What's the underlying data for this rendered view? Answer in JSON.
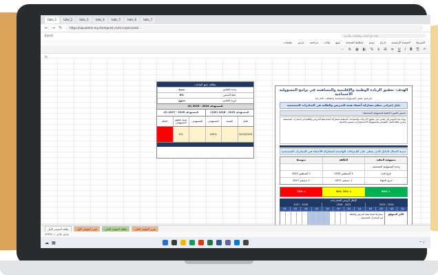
{
  "browser": {
    "tabs": [
      "tabs_1",
      "tabs_2",
      "tabs_3",
      "tabs_4",
      "tabs_5",
      "tabs_6",
      "tabs_7"
    ],
    "url": "https://squadmin-my.sharepoint.com/:x:/personal/...",
    "app_name": "Excel",
    "search_placeholder": "بحث عن أدوات، وتعليمات، والمزيد"
  },
  "menubar": [
    "الشريط",
    "الصفحة الرئيسية",
    "إدراج",
    "رسم",
    "تخطيط الصفحة",
    "صيغ",
    "بيانات",
    "مراجعة",
    "عرض",
    "تعليمات"
  ],
  "left_card": {
    "title": "بطاقة جمع البيانات",
    "rows": [
      {
        "key": "وحدة القياس",
        "value": "نسبة"
      },
      {
        "key": "خط الأساس",
        "value": "0%"
      },
      {
        "key": "دورية القياس",
        "value": "سنوي"
      }
    ],
    "period_main": "المستهدف 2024 - 2025 (0)",
    "periods": [
      "المستهدف 2026 - 2027 (0)",
      "المستهدف 2025 - 2026 (100)"
    ],
    "col_heads": [
      "العام",
      "النتيجة",
      "المستهدف",
      "المستهدف",
      "نسبة تحقيق المستهدف",
      "الحالة"
    ],
    "values": [
      "2023/2024",
      "",
      "100%",
      "",
      "0%",
      ""
    ]
  },
  "right_card": {
    "title": "الهدف: تحقيق الريادة الوطنية والإقليمية والمساهمة في برامج المسؤولية الاجتماعية",
    "subtitle": "البرنامج: تفعيل المسؤولية المجتمعية والعلاقات الخارجية",
    "goal": "دليل إجرائي ينظم مشاركة أعضاء هيئة التدريس والطلبة في المبادرات المجتمعية",
    "indicator": "تحسين الصورة الذهنية للمسؤولية المجتمعية:",
    "description": "يهدف هذا المؤشر إلى قياس مدى تطبيق الإجراءات والسياسات المنظمة لمشاركة أعضاء هيئة التدريس والطلبة في المبادرات المجتمعية وتعزيز ثقافة العمل التطوعي والمسؤولية الاجتماعية لدى منسوبي الجامعة",
    "strip": "نسبة اكتمال الدليل الذي يعطي على الإجراءات الواضحة لمشاركة الأعضاء في المبادرات المجتمعية",
    "grid_head": [
      "مسؤولية التنفيذ",
      "التكلفة",
      "متوسط"
    ],
    "grid_rows": [
      [
        "وحدة المسؤولية المجتمعية",
        "",
        ""
      ],
      [
        "تاريخ البدء",
        "4 أغسطس 2025",
        "1 أغسطس 2025"
      ],
      [
        "تاريخ الانتهاء",
        "1 ديسمبر 2027",
        "1 ديسمبر 2027"
      ]
    ],
    "bars": [
      "> 90%",
      "< 70% 90%",
      "< 70%"
    ],
    "timeline_title": "الإطار الزمني للمخرجات",
    "years": [
      "2024 - 2025",
      "2025 - 2026",
      "2026 - 2027"
    ],
    "quarters": [
      "Q1",
      "Q2",
      "Q3",
      "Q4",
      "Q1",
      "Q2",
      "Q3",
      "Q4",
      "Q1",
      "Q2",
      "Q3",
      "Q4"
    ],
    "bottom_label": "الأثر المتوقع",
    "risk_text": "مشاركة أعضاء هيئة التدريس والطلبة في المبادرات المجتمعية"
  },
  "sheet_tabs": [
    "بطاقة المؤشر الأول",
    "تقرير المؤشر الأول",
    "بطاقة المؤشر الثاني",
    "تقرير المؤشر الثاني"
  ],
  "status_text": "100% — عرض عادي",
  "zoom": "100%"
}
